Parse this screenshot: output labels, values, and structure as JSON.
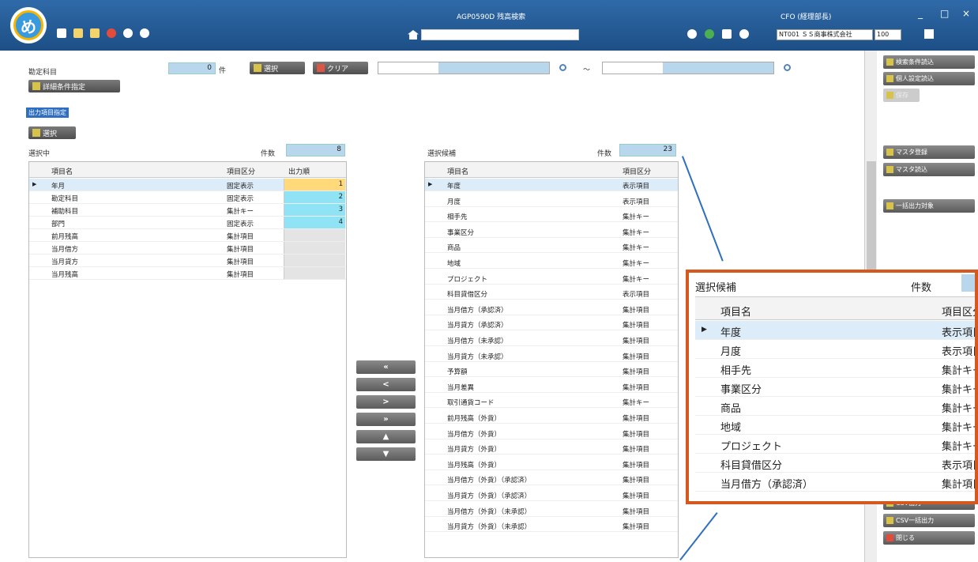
{
  "header": {
    "logo_text": "め",
    "app_title": "AGP0590D 残高検索",
    "user_label": "CFO (経理部長)",
    "company": "NT001 ＳＳ商事株式会社",
    "zoom": "100",
    "minimize": "_",
    "maximize": "□",
    "close": "×"
  },
  "filter": {
    "label": "勘定科目",
    "count": "0",
    "count_unit": "件",
    "select_button": "選択",
    "clear_button": "クリア",
    "range_sep": "～",
    "detail_button": "詳細条件指定"
  },
  "output_section": {
    "tag": "出力項目指定",
    "edit_button": "選択"
  },
  "left_grid": {
    "title": "選択中",
    "count_label": "件数",
    "count": "8",
    "headers": [
      "項目名",
      "項目区分",
      "出力順"
    ],
    "rows": [
      {
        "name": "年月",
        "type": "固定表示",
        "order": "1"
      },
      {
        "name": "勘定科目",
        "type": "固定表示",
        "order": "2"
      },
      {
        "name": "補助科目",
        "type": "集計キー",
        "order": "3"
      },
      {
        "name": "部門",
        "type": "固定表示",
        "order": "4"
      },
      {
        "name": "前月残高",
        "type": "集計項目",
        "order": ""
      },
      {
        "name": "当月借方",
        "type": "集計項目",
        "order": ""
      },
      {
        "name": "当月貸方",
        "type": "集計項目",
        "order": ""
      },
      {
        "name": "当月残高",
        "type": "集計項目",
        "order": ""
      }
    ]
  },
  "move_buttons": [
    "«",
    "<",
    ">",
    "»",
    "▲",
    "▼"
  ],
  "right_grid": {
    "title": "選択候補",
    "count_label": "件数",
    "count": "23",
    "headers": [
      "項目名",
      "項目区分"
    ],
    "rows": [
      {
        "name": "年度",
        "type": "表示項目"
      },
      {
        "name": "月度",
        "type": "表示項目"
      },
      {
        "name": "相手先",
        "type": "集計キー"
      },
      {
        "name": "事業区分",
        "type": "集計キー"
      },
      {
        "name": "商品",
        "type": "集計キー"
      },
      {
        "name": "地域",
        "type": "集計キー"
      },
      {
        "name": "プロジェクト",
        "type": "集計キー"
      },
      {
        "name": "科目貸借区分",
        "type": "表示項目"
      },
      {
        "name": "当月借方（承認済）",
        "type": "集計項目"
      },
      {
        "name": "当月貸方（承認済）",
        "type": "集計項目"
      },
      {
        "name": "当月借方（未承認）",
        "type": "集計項目"
      },
      {
        "name": "当月貸方（未承認）",
        "type": "集計項目"
      },
      {
        "name": "予算額",
        "type": "集計項目"
      },
      {
        "name": "当月差異",
        "type": "集計項目"
      },
      {
        "name": "取引通貨コード",
        "type": "集計キー"
      },
      {
        "name": "前月残高（外貨）",
        "type": "集計項目"
      },
      {
        "name": "当月借方（外貨）",
        "type": "集計項目"
      },
      {
        "name": "当月貸方（外貨）",
        "type": "集計項目"
      },
      {
        "name": "当月残高（外貨）",
        "type": "集計項目"
      },
      {
        "name": "当月借方（外貨）（承認済）",
        "type": "集計項目"
      },
      {
        "name": "当月貸方（外貨）（承認済）",
        "type": "集計項目"
      },
      {
        "name": "当月借方（外貨）（未承認）",
        "type": "集計項目"
      },
      {
        "name": "当月貸方（外貨）（未承認）",
        "type": "集計項目"
      }
    ]
  },
  "side_buttons": [
    "検索条件読込",
    "個人設定読込",
    "保存",
    "マスタ登録",
    "マスタ読込",
    "一括出力対象",
    "CSV出力",
    "CSV一括出力",
    "閉じる"
  ],
  "callout": {
    "title": "選択候補",
    "count_label": "件数",
    "headers": [
      "項目名",
      "項目区分"
    ],
    "rows": [
      {
        "name": "年度",
        "type": "表示項目"
      },
      {
        "name": "月度",
        "type": "表示項目"
      },
      {
        "name": "相手先",
        "type": "集計キー"
      },
      {
        "name": "事業区分",
        "type": "集計キー"
      },
      {
        "name": "商品",
        "type": "集計キー"
      },
      {
        "name": "地域",
        "type": "集計キー"
      },
      {
        "name": "プロジェクト",
        "type": "集計キー"
      },
      {
        "name": "科目貸借区分",
        "type": "表示項目"
      },
      {
        "name": "当月借方（承認済）",
        "type": "集計項目"
      }
    ]
  },
  "colors": {
    "header_bg": "#1d4f86",
    "highlight_orange": "#d5581f",
    "order_yellow": "#ffd97a",
    "order_cyan": "#8fe3f5"
  }
}
